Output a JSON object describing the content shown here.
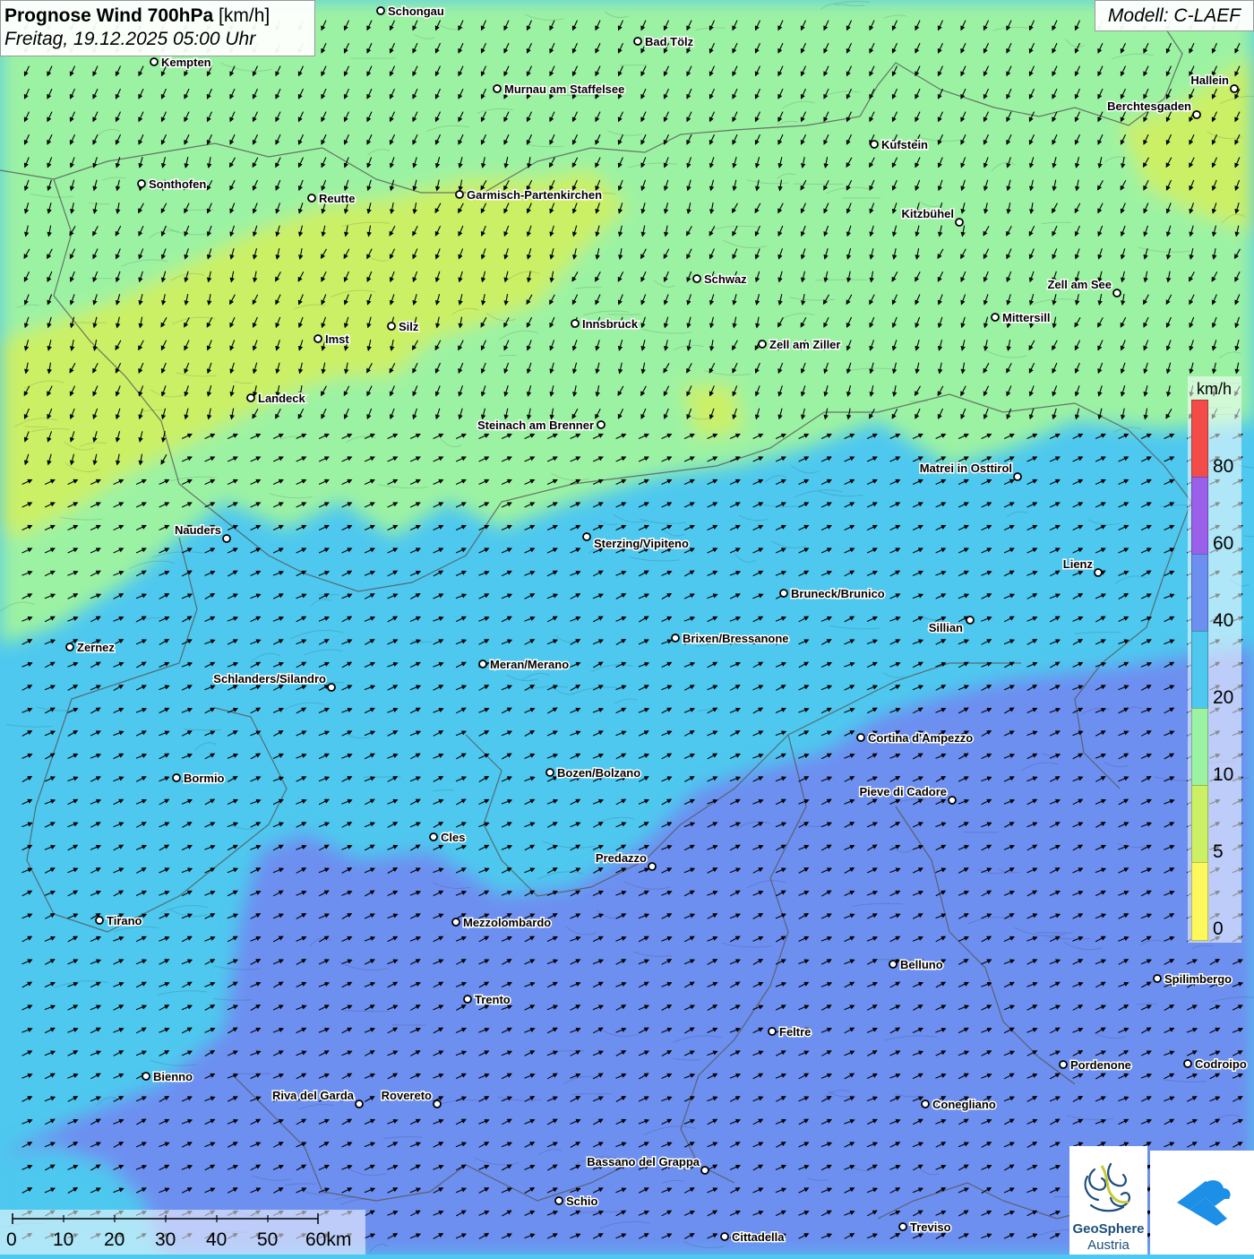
{
  "title": {
    "main": "Prognose Wind 700hPa",
    "unit": "[km/h]",
    "datetime": "Freitag, 19.12.2025 05:00 Uhr"
  },
  "model_label": "Modell: C-LAEF",
  "wind_direction": "southwest",
  "colors": {
    "0-5": "#fcf85e",
    "5-10": "#cbf066",
    "10-20": "#9cf2a3",
    "20-40": "#4ec8ef",
    "40-60": "#6d8ff0",
    "60-80": "#9b60ea",
    "80+": "#f24b48"
  },
  "legend": {
    "unit": "km/h",
    "labels": [
      "80",
      "60",
      "40",
      "20",
      "10",
      "5",
      "0"
    ],
    "segments": [
      "#f24b48",
      "#9b60ea",
      "#6d8ff0",
      "#4ec8ef",
      "#9cf2a3",
      "#cbf066",
      "#fcf85e"
    ]
  },
  "scalebar": {
    "labels": [
      "0",
      "10",
      "20",
      "30",
      "40",
      "50",
      "60km"
    ]
  },
  "logo": {
    "line1": "GeoSphere",
    "line2": "Austria"
  },
  "cities": [
    {
      "name": "Schongau"
    },
    {
      "name": "Bad Tölz"
    },
    {
      "name": "Kempten"
    },
    {
      "name": "Murnau am Staffelsee"
    },
    {
      "name": "Hallein"
    },
    {
      "name": "Berchtesgaden"
    },
    {
      "name": "Kufstein"
    },
    {
      "name": "Sonthofen"
    },
    {
      "name": "Reutte"
    },
    {
      "name": "Garmisch-Partenkirchen"
    },
    {
      "name": "Kitzbühel"
    },
    {
      "name": "Schwaz"
    },
    {
      "name": "Zell am See"
    },
    {
      "name": "Mittersill"
    },
    {
      "name": "Innsbruck"
    },
    {
      "name": "Silz"
    },
    {
      "name": "Imst"
    },
    {
      "name": "Zell am Ziller"
    },
    {
      "name": "Landeck"
    },
    {
      "name": "Steinach am Brenner"
    },
    {
      "name": "Matrei in Osttirol"
    },
    {
      "name": "Nauders"
    },
    {
      "name": "Sterzing/Vipiteno"
    },
    {
      "name": "Lienz"
    },
    {
      "name": "Bruneck/Brunico"
    },
    {
      "name": "Sillian"
    },
    {
      "name": "Brixen/Bressanone"
    },
    {
      "name": "Zernez"
    },
    {
      "name": "Meran/Merano"
    },
    {
      "name": "Schlanders/Silandro"
    },
    {
      "name": "Cortina d'Ampezzo"
    },
    {
      "name": "Bormio"
    },
    {
      "name": "Bozen/Bolzano"
    },
    {
      "name": "Pieve di Cadore"
    },
    {
      "name": "Cles"
    },
    {
      "name": "Predazzo"
    },
    {
      "name": "Tirano"
    },
    {
      "name": "Mezzolombardo"
    },
    {
      "name": "Belluno"
    },
    {
      "name": "Spilimbergo"
    },
    {
      "name": "Trento"
    },
    {
      "name": "Feltre"
    },
    {
      "name": "Pordenone"
    },
    {
      "name": "Codroipo"
    },
    {
      "name": "Bienno"
    },
    {
      "name": "Riva del Garda"
    },
    {
      "name": "Rovereto"
    },
    {
      "name": "Conegliano"
    },
    {
      "name": "Bassano del Grappa"
    },
    {
      "name": "Schio"
    },
    {
      "name": "Treviso"
    },
    {
      "name": "Cittadella"
    }
  ]
}
